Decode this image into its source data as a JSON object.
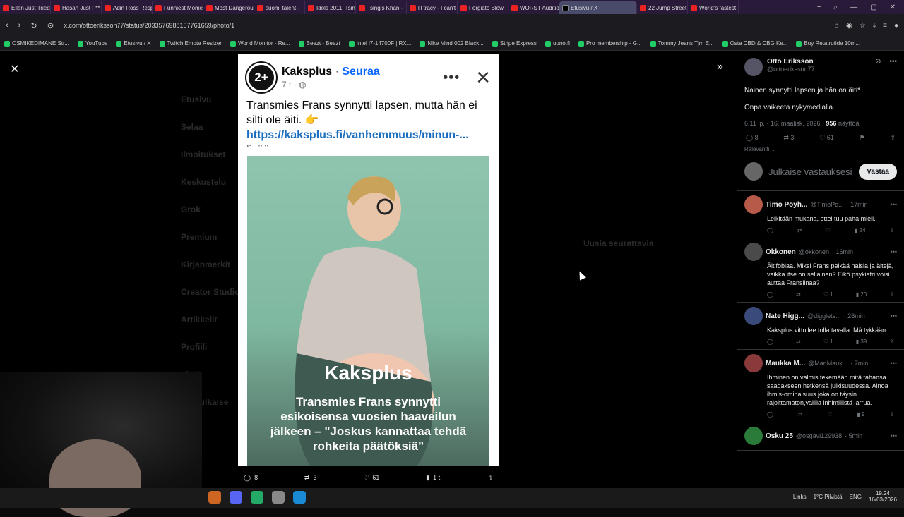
{
  "browser": {
    "tabs": [
      "Ellen Just Tried",
      "Hasan Just F**",
      "Adin Ross Resp",
      "Funniest Mome",
      "Most Dangerou",
      "suomi talent -",
      "Idols 2011: Tsin",
      "Tsingis Khan -",
      "lil tracy - I can't",
      "Forgiato Blow",
      "WORST Auditio",
      "Etusivu / X",
      "22 Jump Street",
      "World's fastest"
    ],
    "active_tab": "Etusivu / X",
    "url": "x.com/ottoeriksson77/status/2033576988157761659/photo/1",
    "bookmarks": [
      "OSMIKEDIMANE Str...",
      "YouTube",
      "Etusivu / X",
      "Twitch Emote Resizer",
      "World Monitor - Re...",
      "Beezt - Beezt",
      "Intel i7-14700F | RX...",
      "Nike Mind 002 Black...",
      "Stripe Express",
      "uuno.fi",
      "Pro membership - G...",
      "Tommy Jeans Tjm E...",
      "Osta CBD & CBG Ke...",
      "Buy Retatrutide 10m..."
    ]
  },
  "background_x": {
    "nav": [
      "Etusivu",
      "Selaa",
      "Ilmoitukset",
      "Keskustelu",
      "Grok",
      "Premium",
      "Kirjanmerkit",
      "Creator Studio",
      "Artikkelit",
      "Profiili",
      "Lisää"
    ],
    "post_button": "Julkaise",
    "side_heading": "Uusia seurattavia"
  },
  "fb_post": {
    "page_name": "Kaksplus",
    "separator": "·",
    "follow": "Seuraa",
    "time": "7 t ·",
    "logo_text": "2+",
    "text": "Transmies Frans synnytti lapsen, mutta hän ei silti ole äiti. 👉",
    "link": "https://kaksplus.fi/vanhemmuus/minun-...",
    "more": "lisää",
    "photo_brand": "Kaksplus",
    "photo_headline": "Transmies Frans synnytti esikoisensa vuosien haaveilun jälkeen – \"Joskus kannattaa tehdä rohkeita päätöksiä\""
  },
  "viewer_actions": {
    "replies": "8",
    "reposts": "3",
    "likes": "61",
    "views": "1 t."
  },
  "side_tweet": {
    "name": "Otto Eriksson",
    "handle": "@ottoeriksson77",
    "line1": "Nainen synnytti lapsen ja hän on äiti*",
    "line2": "Onpa vaikeeta nykymedialla.",
    "meta_prefix": "6.11 ip. · 16. maalisk. 2026 ·",
    "views_count": "956",
    "views_label": "näyttöä",
    "replies": "8",
    "reposts": "3",
    "likes": "61",
    "sort": "Relevantti ⌄",
    "compose_placeholder": "Julkaise vastauksesi",
    "reply_button": "Vastaa"
  },
  "replies": [
    {
      "name": "Timo Pöyh...",
      "handle": "@TimoPo...",
      "time": "· 17min",
      "text": "Leikitään mukana, ettei tuu paha mieli.",
      "replies": "",
      "reposts": "",
      "likes": "",
      "views": "24",
      "color": "#b85a4a"
    },
    {
      "name": "Okkonen",
      "handle": "@okkonen",
      "time": "· 16min",
      "text": "Äitifobiaa. Miksi Frans pelkää naisia ja äitejä, vaikka itse on sellainen? Eikö psykiatri voisi auttaa Fransiinaa?",
      "replies": "",
      "reposts": "",
      "likes": "1",
      "views": "20",
      "color": "#4a4a4a"
    },
    {
      "name": "Nate Higg...",
      "handle": "@digglets...",
      "time": "· 26min",
      "text": "Kaksplus vittuilee tolla tavalla. Mä tykkään.",
      "replies": "",
      "reposts": "",
      "likes": "1",
      "views": "39",
      "color": "#3a4a7a"
    },
    {
      "name": "Maukka M...",
      "handle": "@ManMauk...",
      "time": "· 7min",
      "text": "Ihminen on valmis tekemään mitä tahansa saadakseen hetkensä julkisuudessa. Ainoa ihmis-ominaisuus joka on täysin rajoittamaton,vaillia inhimillistä jarrua.",
      "replies": "",
      "reposts": "",
      "likes": "",
      "views": "9",
      "color": "#8a3a3a"
    },
    {
      "name": "Osku 25",
      "handle": "@osgavi129938",
      "time": "· 5min",
      "text": "",
      "replies": "",
      "reposts": "",
      "likes": "",
      "views": "",
      "color": "#2a7a3a"
    }
  ],
  "taskbar": {
    "links": "Links",
    "weather": "1°C Pilvistä",
    "lang": "ENG",
    "time": "19.24",
    "date": "16/03/2026"
  }
}
